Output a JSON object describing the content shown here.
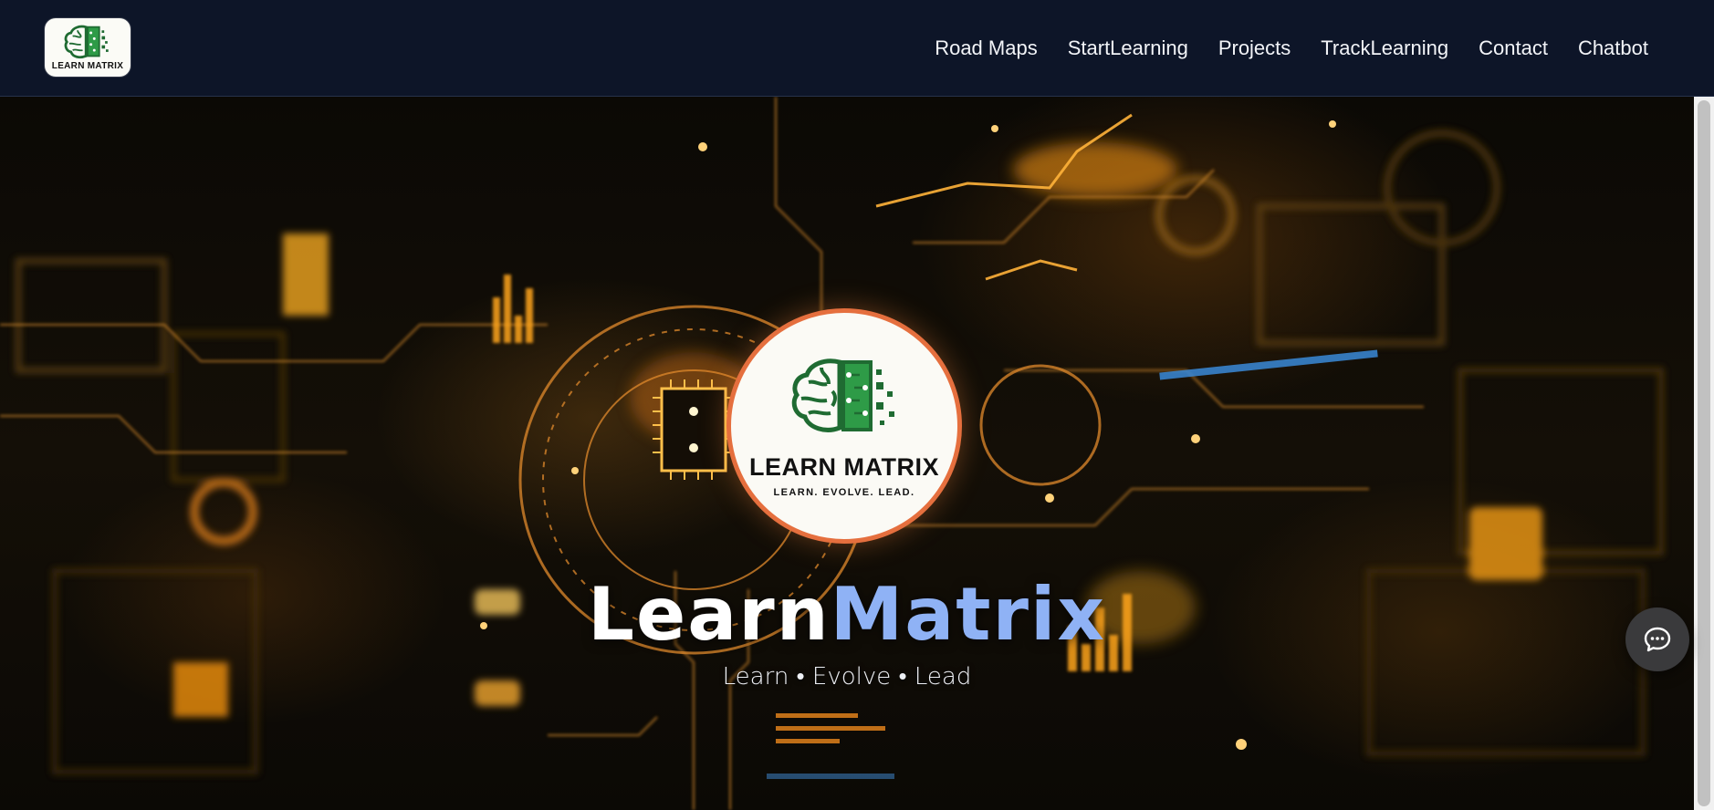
{
  "brand": {
    "logo_text": "LEARN MATRIX",
    "logo_tagline": "LEARN. EVOLVE. LEAD.",
    "icon": "brain-circuit-icon"
  },
  "nav": {
    "links": [
      "Road Maps",
      "StartLearning",
      "Projects",
      "TrackLearning",
      "Contact",
      "Chatbot"
    ]
  },
  "hero": {
    "title_part1": "Learn",
    "title_part2": "Matrix",
    "tagline": "Learn • Evolve • Lead"
  },
  "chat_button": {
    "icon": "chat-bubble-icon"
  },
  "colors": {
    "navbar_bg": "#0d1528",
    "title_accent": "#8fb2f5",
    "logo_ring": "#e56f3e",
    "brand_green": "#2e9b47"
  }
}
